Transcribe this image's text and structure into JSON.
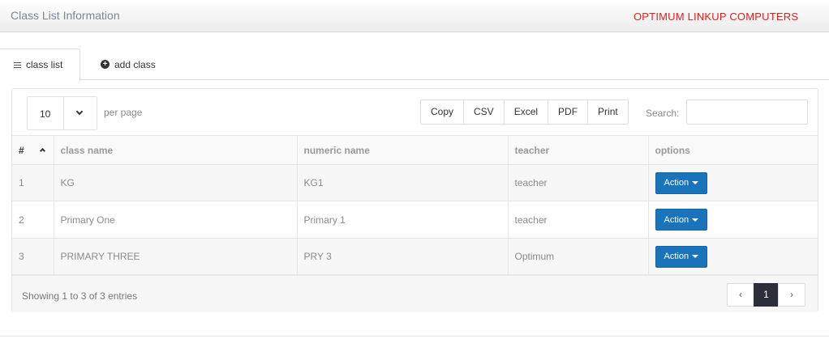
{
  "header": {
    "title": "Class List Information",
    "brand": "OPTIMUM LINKUP COMPUTERS",
    "brand_color": "#e0201e"
  },
  "tabs": [
    {
      "label": "class list",
      "icon": "menu-icon",
      "active": true
    },
    {
      "label": "add class",
      "icon": "plus-circle-icon",
      "active": false
    }
  ],
  "table_controls": {
    "length_value": "10",
    "per_page_label": "per page",
    "export_buttons": [
      "Copy",
      "CSV",
      "Excel",
      "PDF",
      "Print"
    ],
    "search_label": "Search:",
    "search_value": ""
  },
  "table": {
    "columns": [
      "#",
      "class name",
      "numeric name",
      "teacher",
      "options"
    ],
    "sort_column": "#",
    "sort_direction": "ascending",
    "rows": [
      {
        "num": "1",
        "class_name": "KG",
        "numeric_name": "KG1",
        "teacher": "teacher",
        "action": "Action"
      },
      {
        "num": "2",
        "class_name": "Primary One",
        "numeric_name": "Primary 1",
        "teacher": "teacher",
        "action": "Action"
      },
      {
        "num": "3",
        "class_name": "PRIMARY THREE",
        "numeric_name": "PRY 3",
        "teacher": "Optimum",
        "action": "Action"
      }
    ]
  },
  "footer": {
    "info": "Showing 1 to 3 of 3 entries",
    "pagination": {
      "prev": "‹",
      "current": "1",
      "next": "›"
    }
  },
  "colors": {
    "action_button": "#1a74bb",
    "pager_active": "#2b2f3a"
  }
}
